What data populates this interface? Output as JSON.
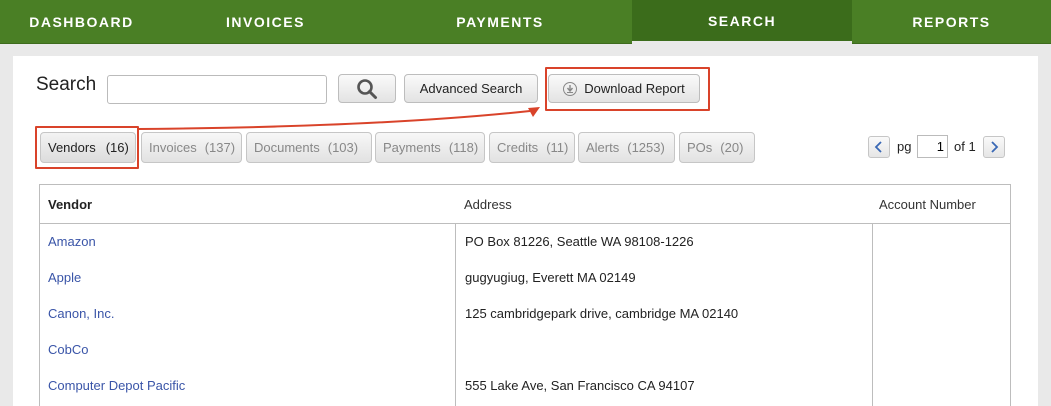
{
  "nav": {
    "items": [
      {
        "label": "DASHBOARD"
      },
      {
        "label": "INVOICES"
      },
      {
        "label": "PAYMENTS"
      },
      {
        "label": "SEARCH"
      },
      {
        "label": "REPORTS"
      }
    ]
  },
  "search": {
    "label": "Search",
    "query": "",
    "advanced_label": "Advanced Search",
    "download_label": "Download Report"
  },
  "tabs": [
    {
      "label": "Vendors",
      "count": "(16)"
    },
    {
      "label": "Invoices",
      "count": "(137)"
    },
    {
      "label": "Documents",
      "count": "(103)"
    },
    {
      "label": "Payments",
      "count": "(118)"
    },
    {
      "label": "Credits",
      "count": "(11)"
    },
    {
      "label": "Alerts",
      "count": "(1253)"
    },
    {
      "label": "POs",
      "count": "(20)"
    }
  ],
  "pager": {
    "pg_label": "pg",
    "current": "1",
    "of_label": "of 1"
  },
  "table": {
    "headers": [
      "Vendor",
      "Address",
      "Account Number"
    ],
    "rows": [
      {
        "vendor": "Amazon",
        "address": "PO Box 81226, Seattle WA 98108-1226",
        "account": ""
      },
      {
        "vendor": "Apple",
        "address": "gugyugiug, Everett MA 02149",
        "account": ""
      },
      {
        "vendor": "Canon, Inc.",
        "address": "125 cambridgepark drive, cambridge MA 02140",
        "account": ""
      },
      {
        "vendor": "CobCo",
        "address": "",
        "account": ""
      },
      {
        "vendor": "Computer Depot Pacific",
        "address": "555 Lake Ave, San Francisco CA 94107",
        "account": ""
      }
    ]
  },
  "colors": {
    "nav_bg": "#4a7f25",
    "nav_active": "#3b6c1b",
    "highlight": "#d9432a",
    "link": "#3a55a8"
  }
}
